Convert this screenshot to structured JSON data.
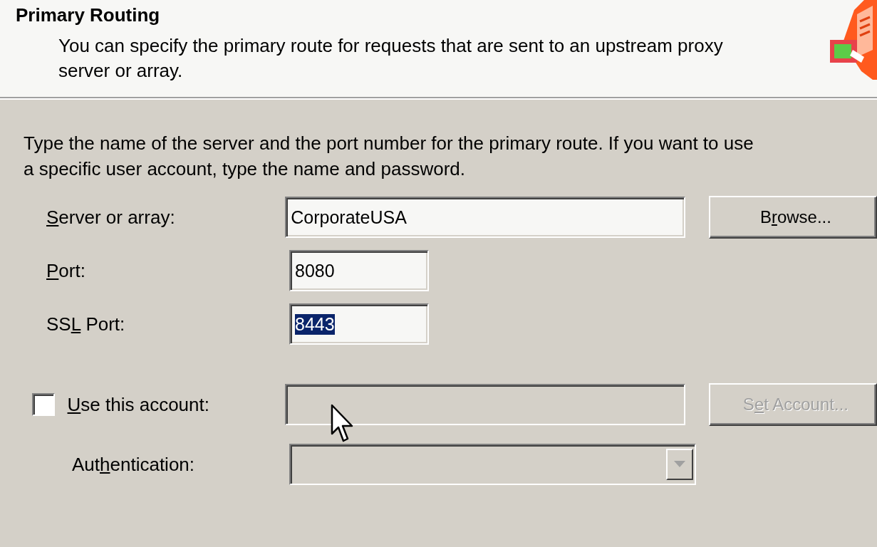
{
  "header": {
    "title": "Primary Routing",
    "subtitle": "You can specify the primary route for requests that are sent to an upstream proxy server or array."
  },
  "instructions": "Type the name of the server and the port number for the primary route. If you want to use a specific user account, type the name and password.",
  "fields": [
    {
      "kind": "text",
      "label_parts": [
        {
          "text": "S",
          "underlined": true
        },
        {
          "text": "erver or array:",
          "underlined": false
        }
      ],
      "value": "CorporateUSA",
      "text_selected": false,
      "disabled": false,
      "button": {
        "label_parts": [
          {
            "text": "B",
            "underlined": false
          },
          {
            "text": "r",
            "underlined": true
          },
          {
            "text": "owse...",
            "underlined": false
          }
        ],
        "disabled": false
      }
    },
    {
      "kind": "number",
      "label_parts": [
        {
          "text": "P",
          "underlined": true
        },
        {
          "text": "ort:",
          "underlined": false
        }
      ],
      "value": "8080",
      "text_selected": false,
      "disabled": false
    },
    {
      "kind": "number",
      "label_parts": [
        {
          "text": "SS",
          "underlined": false
        },
        {
          "text": "L",
          "underlined": true
        },
        {
          "text": " Port:",
          "underlined": false
        }
      ],
      "value": "8443",
      "text_selected": true,
      "disabled": false
    },
    {
      "kind": "checkbox",
      "label_parts": [
        {
          "text": "U",
          "underlined": true
        },
        {
          "text": "se this account:",
          "underlined": false
        }
      ],
      "checked": false,
      "disabled": true,
      "button": {
        "label_parts": [
          {
            "text": "S",
            "underlined": false
          },
          {
            "text": "e",
            "underlined": true
          },
          {
            "text": "t Account...",
            "underlined": false
          }
        ],
        "disabled": true
      }
    },
    {
      "kind": "dropdown",
      "label_parts": [
        {
          "text": "Aut",
          "underlined": false
        },
        {
          "text": "h",
          "underlined": true
        },
        {
          "text": "entication:",
          "underlined": false
        }
      ],
      "disabled": true
    }
  ]
}
